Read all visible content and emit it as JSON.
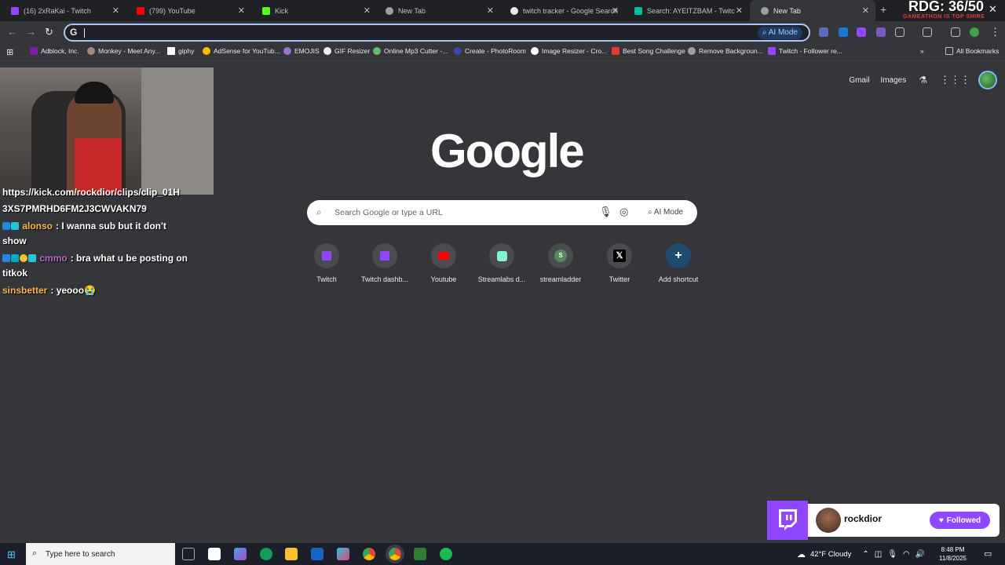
{
  "tabs": [
    {
      "label": "(16) 2xRaKai - Twitch",
      "color": "#9146ff"
    },
    {
      "label": "(799) YouTube",
      "color": "#ff0000"
    },
    {
      "label": "Kick",
      "color": "#53fc18"
    },
    {
      "label": "New Tab",
      "color": "#9aa0a6"
    },
    {
      "label": "twitch tracker - Google Search",
      "color": "#e8eaed"
    },
    {
      "label": "Search: AYEITZBAM - TwitchTra",
      "color": "#00bfa5"
    },
    {
      "label": "New Tab",
      "color": "#9aa0a6"
    }
  ],
  "toolbar": {
    "omnibox_value": "",
    "ai_mode_label": "AI Mode"
  },
  "bookmarks": [
    "Adblock, Inc.",
    "Monkey - Meet Any...",
    "giphy",
    "AdSense for YouTub...",
    "EMOJIS",
    "GIF Resizer",
    "Online Mp3 Cutter -...",
    "Create - PhotoRoom",
    "Image Resizer - Cro...",
    "Best Song Challenge",
    "Remove Backgroun...",
    "Twitch - Follower re..."
  ],
  "all_bookmarks_label": "All Bookmarks",
  "newtab": {
    "gmail": "Gmail",
    "images": "Images",
    "logo": "Google",
    "search_placeholder": "Search Google or type a URL",
    "ai_mode": "AI Mode",
    "shortcuts": [
      "Twitch",
      "Twitch dashb...",
      "Youtube",
      "Streamlabs d...",
      "streamladder",
      "Twitter",
      "Add shortcut"
    ]
  },
  "overlay": {
    "rdg": "RDG: 36/50",
    "rdg_sub": "GAMEATHON IS TOP SHIRE",
    "chat": [
      {
        "user": "",
        "text": "https://kick.com/rockdior/clips/clip_01H"
      },
      {
        "user": "",
        "text": "3XS7PMRHD6FM2J3CWVAKN79"
      },
      {
        "user": "alonso",
        "text": ": I wanna sub but it don't show",
        "color": "#ffb74d"
      },
      {
        "user": "cmmo",
        "text": ": bra what u be posting on titkok",
        "color": "#ba68c8"
      },
      {
        "user": "sinsbetter",
        "text": ": yeooo😭",
        "color": "#ffb74d"
      }
    ],
    "follow_name": "rockdior",
    "follow_button": "Followed"
  },
  "taskbar": {
    "search_placeholder": "Type here to search",
    "weather": "42°F  Cloudy",
    "time": "8:48 PM",
    "date": "11/8/2025"
  }
}
